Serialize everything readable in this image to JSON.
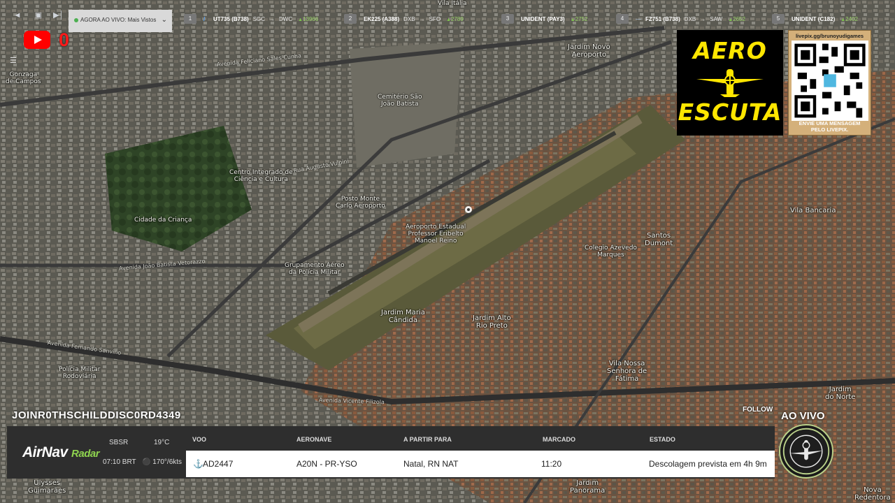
{
  "topbar": {
    "live_selector": "AGORA AO VIVO: Mais Vistos",
    "flights": [
      {
        "index": "1",
        "callsign": "UT735 (B738)",
        "from": "SGC",
        "to": "DWC",
        "altitude": "13966"
      },
      {
        "index": "2",
        "callsign": "EK225 (A388)",
        "from": "DXB",
        "to": "SFO",
        "altitude": "2789"
      },
      {
        "index": "3",
        "callsign": "UNIDENT (PAY3)",
        "from": "",
        "to": "",
        "altitude": "2752"
      },
      {
        "index": "4",
        "callsign": "FZ751 (B738)",
        "from": "DXB",
        "to": "SAW",
        "altitude": "2652"
      },
      {
        "index": "5",
        "callsign": "UNIDENT (C182)",
        "from": "",
        "to": "",
        "altitude": "2402"
      }
    ]
  },
  "youtube": {
    "count": "0"
  },
  "map_labels": {
    "gonzaga": "Gonzaga\nde Campos",
    "jardim_novo": "Jardim Novo\nAeroporto",
    "cemiterio": "Cemitério São\nJoão Batista",
    "centro_integrado": "Centro Integrado de\nCiência e Cultura",
    "posto": "Posto Monte\nCarlo Aeroporto",
    "cidade_crianca": "Cidade da Criança",
    "aeroporto": "Aeroporto Estadual\nProfessor Eribelto\nManoel Reino",
    "grupamento": "Grupamento Aéreo\nda Polícia Militar",
    "santos_dumont": "Santos\nDumont",
    "vila_bancaria": "Vila Bancaria",
    "colegio": "Colegio Azevedo\nMarques",
    "jardim_maria": "Jardim Maria\nCândida",
    "jardim_alto": "Jardim Alto\nRio Preto",
    "vila_nossa": "Vila Nossa\nSenhora de\nFátima",
    "jardim_norte": "Jardim\ndo Norte",
    "policia_militar": "Polícia Militar\nRodoviária",
    "vila_italia": "Vila Itália",
    "ulysses": "Ulysses\nGuimarães",
    "jardim_panorama": "Jardim\nPanorama",
    "nova_redentora": "Nova\nRedentora",
    "road_feliciano": "Avenida Feliciano Sales Cunha",
    "road_joao_batista": "Avenida João Batista Vetorazzo",
    "road_fernando": "Avenida Fernando Sanvino",
    "road_vicente": "Avenida Vicente Filizola",
    "road_augusto": "Rua Augusto Vulpini"
  },
  "logo": {
    "line1": "AERO",
    "line2": "ESCUTA"
  },
  "qr": {
    "url": "livepix.gg/brunoyudigames",
    "message": "ENVIE UMA MENSAGEM\nPELO LIVEPIX."
  },
  "bottom": {
    "channel": "JOINR0THSCHILDDISC0RD4349",
    "follow": "FOLLOW",
    "ao_vivo": "AO VIVO",
    "brand": "AirNav",
    "brand_suffix": "Radar",
    "airport": "SBSR",
    "temp": "19°C",
    "time": "07:10 BRT",
    "wind": "170°/6kts",
    "columns": {
      "voo": "VOO",
      "aeronave": "AERONAVE",
      "partir": "A PARTIR PARA",
      "marcado": "MARCADO",
      "estado": "ESTADO"
    },
    "row": {
      "voo": "AD2447",
      "aeronave": "A20N - PR-YSO",
      "partir": "Natal, RN NAT",
      "marcado": "11:20",
      "estado": "Descolagem prevista em 4h 9m"
    }
  }
}
